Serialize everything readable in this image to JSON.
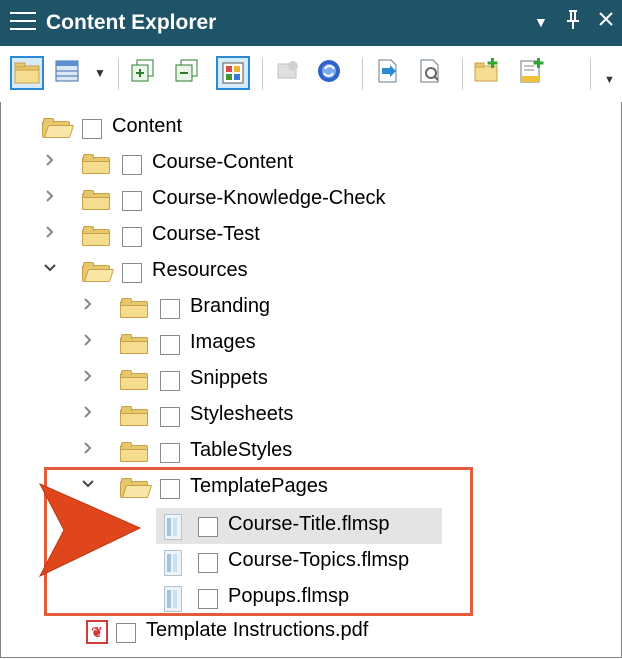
{
  "panel": {
    "title": "Content Explorer",
    "menu_icon": "hamburger-icon",
    "pin_icon": "pin-icon",
    "close_icon": "close-icon",
    "dropdown_icon": "caret-down-icon"
  },
  "toolbar": {
    "buttons": [
      {
        "name": "show-folders",
        "icon": "folder-icon",
        "active": true
      },
      {
        "name": "view-options",
        "icon": "grid-icon",
        "active": false
      },
      {
        "name": "expand-all",
        "icon": "expand-icon",
        "active": false
      },
      {
        "name": "collapse-all",
        "icon": "collapse-icon",
        "active": false
      },
      {
        "name": "show-files",
        "icon": "tiles-icon",
        "active": true
      },
      {
        "name": "bind",
        "icon": "bind-icon",
        "active": false
      },
      {
        "name": "refresh",
        "icon": "refresh-icon",
        "active": false
      },
      {
        "name": "open-file",
        "icon": "document-arrow-icon",
        "active": false
      },
      {
        "name": "properties",
        "icon": "properties-icon",
        "active": false
      },
      {
        "name": "new-folder",
        "icon": "new-folder-icon",
        "active": false
      },
      {
        "name": "new-item",
        "icon": "new-item-icon",
        "active": false
      }
    ]
  },
  "tree": {
    "items": [
      {
        "label": "Content",
        "type": "folder",
        "open": true,
        "expanded": null
      },
      {
        "label": "Course-Content",
        "type": "folder",
        "open": false,
        "expanded": false
      },
      {
        "label": "Course-Knowledge-Check",
        "type": "folder",
        "open": false,
        "expanded": false
      },
      {
        "label": "Course-Test",
        "type": "folder",
        "open": false,
        "expanded": false
      },
      {
        "label": "Resources",
        "type": "folder",
        "open": true,
        "expanded": true
      },
      {
        "label": "Branding",
        "type": "folder",
        "open": false,
        "expanded": false
      },
      {
        "label": "Images",
        "type": "folder",
        "open": false,
        "expanded": false
      },
      {
        "label": "Snippets",
        "type": "folder",
        "open": false,
        "expanded": false
      },
      {
        "label": "Stylesheets",
        "type": "folder",
        "open": false,
        "expanded": false
      },
      {
        "label": "TableStyles",
        "type": "folder",
        "open": false,
        "expanded": false
      },
      {
        "label": "TemplatePages",
        "type": "folder",
        "open": true,
        "expanded": true
      },
      {
        "label": "Course-Title.flmsp",
        "type": "page",
        "selected": true
      },
      {
        "label": "Course-Topics.flmsp",
        "type": "page",
        "selected": false
      },
      {
        "label": "Popups.flmsp",
        "type": "page",
        "selected": false
      },
      {
        "label": "Template Instructions.pdf",
        "type": "pdf",
        "selected": false
      }
    ]
  },
  "colors": {
    "titlebar": "#1f5468",
    "highlight_box": "#e35b3b",
    "arrow": "#e0461c",
    "selection": "#e4e4e4"
  }
}
